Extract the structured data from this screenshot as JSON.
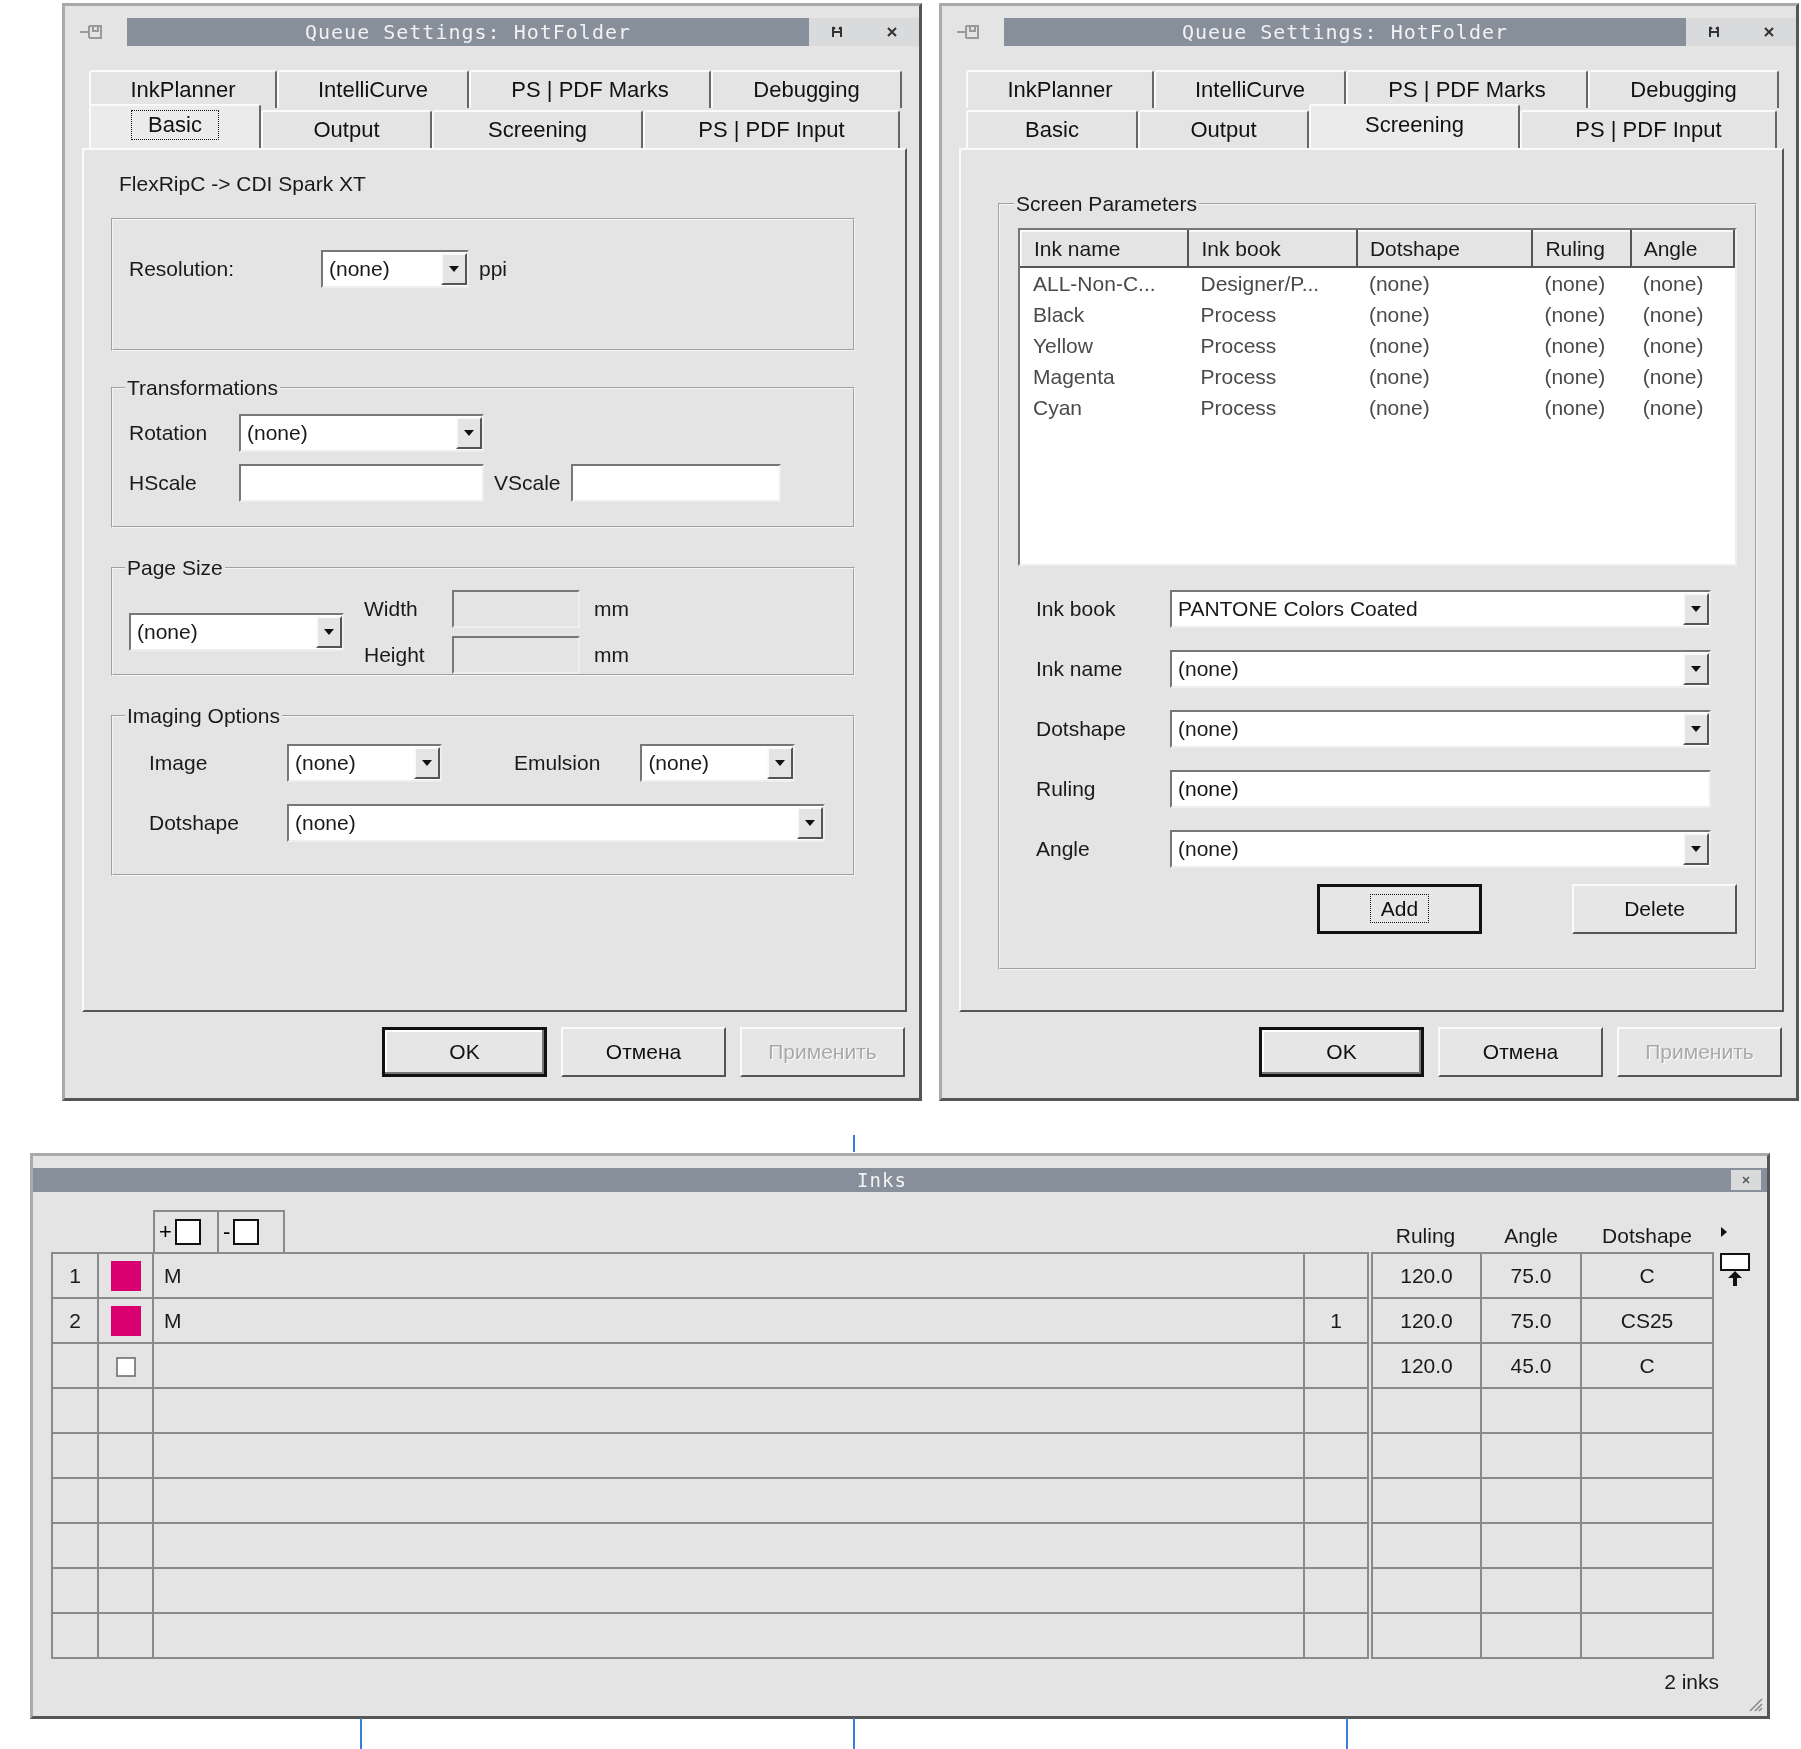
{
  "dialogs": [
    {
      "title": "Queue Settings: HotFolder",
      "tab_rows": [
        [
          {
            "label": "InkPlanner",
            "selected": false,
            "focused": false
          },
          {
            "label": "IntelliCurve",
            "selected": false,
            "focused": false
          },
          {
            "label": "PS | PDF Marks",
            "selected": false,
            "focused": false
          },
          {
            "label": "Debugging",
            "selected": false,
            "focused": false
          }
        ],
        [
          {
            "label": "Basic",
            "selected": true,
            "focused": true
          },
          {
            "label": "Output",
            "selected": false,
            "focused": false
          },
          {
            "label": "Screening",
            "selected": false,
            "focused": false
          },
          {
            "label": "PS | PDF Input",
            "selected": false,
            "focused": false
          }
        ]
      ],
      "panel": {
        "kind": "basic",
        "subtitle": "FlexRipC -> CDI Spark XT",
        "resolution": {
          "label": "Resolution:",
          "value": "(none)",
          "unit": "ppi"
        },
        "transformations": {
          "title": "Transformations",
          "rotation": {
            "label": "Rotation",
            "value": "(none)"
          },
          "hscale": {
            "label": "HScale"
          },
          "vscale": {
            "label": "VScale"
          }
        },
        "page_size": {
          "title": "Page Size",
          "value": "(none)",
          "width": {
            "label": "Width",
            "unit": "mm",
            "disabled": true
          },
          "height": {
            "label": "Height",
            "unit": "mm",
            "disabled": true
          }
        },
        "imaging_options": {
          "title": "Imaging Options",
          "image": {
            "label": "Image",
            "value": "(none)"
          },
          "emulsion": {
            "label": "Emulsion",
            "value": "(none)"
          },
          "dotshape": {
            "label": "Dotshape",
            "value": "(none)"
          }
        }
      },
      "buttons": [
        {
          "label": "OK",
          "default": true,
          "disabled": false
        },
        {
          "label": "Отмена",
          "default": false,
          "disabled": false
        },
        {
          "label": "Применить",
          "default": false,
          "disabled": true
        }
      ]
    },
    {
      "title": "Queue Settings: HotFolder",
      "tab_rows": [
        [
          {
            "label": "InkPlanner",
            "selected": false,
            "focused": false
          },
          {
            "label": "IntelliCurve",
            "selected": false,
            "focused": false
          },
          {
            "label": "PS | PDF Marks",
            "selected": false,
            "focused": false
          },
          {
            "label": "Debugging",
            "selected": false,
            "focused": false
          }
        ],
        [
          {
            "label": "Basic",
            "selected": false,
            "focused": false
          },
          {
            "label": "Output",
            "selected": false,
            "focused": false
          },
          {
            "label": "Screening",
            "selected": true,
            "focused": false
          },
          {
            "label": "PS | PDF Input",
            "selected": false,
            "focused": false
          }
        ]
      ],
      "panel": {
        "kind": "screening",
        "group_title": "Screen Parameters",
        "list": {
          "columns": [
            "Ink name",
            "Ink book",
            "Dotshape",
            "Ruling",
            "Angle"
          ],
          "rows": [
            [
              "ALL-Non-C...",
              "Designer/P...",
              "(none)",
              "(none)",
              "(none)"
            ],
            [
              "Black",
              "Process",
              "(none)",
              "(none)",
              "(none)"
            ],
            [
              "Yellow",
              "Process",
              "(none)",
              "(none)",
              "(none)"
            ],
            [
              "Magenta",
              "Process",
              "(none)",
              "(none)",
              "(none)"
            ],
            [
              "Cyan",
              "Process",
              "(none)",
              "(none)",
              "(none)"
            ]
          ]
        },
        "fields": [
          {
            "label": "Ink book",
            "value": "PANTONE Colors Coated",
            "kind": "dropdown"
          },
          {
            "label": "Ink name",
            "value": "(none)",
            "kind": "dropdown"
          },
          {
            "label": "Dotshape",
            "value": "(none)",
            "kind": "dropdown"
          },
          {
            "label": "Ruling",
            "value": "(none)",
            "kind": "text"
          },
          {
            "label": "Angle",
            "value": "(none)",
            "kind": "dropdown"
          }
        ],
        "actions": [
          {
            "label": "Add",
            "focused": true
          },
          {
            "label": "Delete",
            "focused": false
          }
        ]
      },
      "buttons": [
        {
          "label": "OK",
          "default": true,
          "disabled": false
        },
        {
          "label": "Отмена",
          "default": false,
          "disabled": false
        },
        {
          "label": "Применить",
          "default": false,
          "disabled": true
        }
      ]
    }
  ],
  "inks": {
    "title": "Inks",
    "toolbar": [
      {
        "label": "+"
      },
      {
        "label": "-"
      }
    ],
    "columns": [
      "Ruling",
      "Angle",
      "Dotshape"
    ],
    "rows": [
      {
        "kind": "ink",
        "number": "1",
        "color": "#db006f",
        "name": "M",
        "ruling": "120.0",
        "angle": "75.0",
        "dotshape": "C"
      },
      {
        "kind": "ink",
        "number": "2",
        "color": "#db006f",
        "name": "M",
        "column_4": "1",
        "ruling": "120.0",
        "angle": "75.0",
        "dotshape": "CS25"
      },
      {
        "kind": "blank",
        "ruling": "120.0",
        "angle": "45.0",
        "dotshape": "C"
      }
    ],
    "status": "2 inks"
  }
}
